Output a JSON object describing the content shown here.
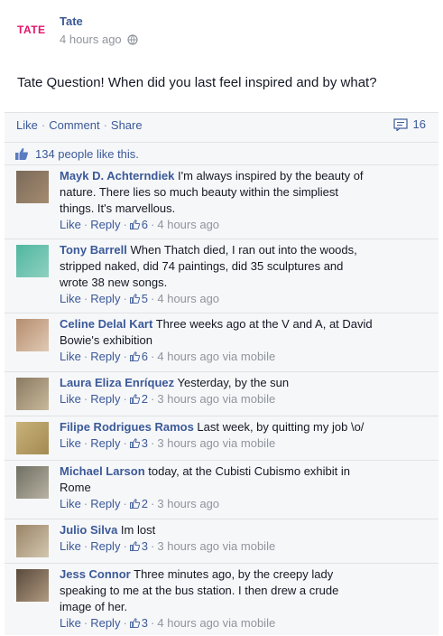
{
  "post": {
    "logo": "TATE",
    "author": "Tate",
    "time": "4 hours ago",
    "text": "Tate Question! When did you last feel inspired and by what?"
  },
  "actions": {
    "like": "Like",
    "comment": "Comment",
    "share": "Share",
    "comment_count": "16"
  },
  "likes": {
    "text": "134 people like this."
  },
  "comments": [
    {
      "name": "Mayk D. Achterndiek",
      "lines": [
        "I'm always inspired by the beauty of",
        "nature. There lies so much beauty within the simpliest",
        "things. It's marvellous."
      ],
      "like": "Like",
      "reply": "Reply",
      "likes": "6",
      "time": "4 hours ago",
      "via": ""
    },
    {
      "name": "Tony Barrell",
      "lines": [
        "When Thatch died, I ran out into the woods,",
        "stripped naked, did 74 paintings, did 35 sculptures and",
        "wrote 38 new songs."
      ],
      "like": "Like",
      "reply": "Reply",
      "likes": "5",
      "time": "4 hours ago",
      "via": ""
    },
    {
      "name": "Celine Delal Kart",
      "lines": [
        "Three weeks ago at the V and A, at David",
        "Bowie's exhibition"
      ],
      "like": "Like",
      "reply": "Reply",
      "likes": "6",
      "time": "4 hours ago",
      "via": "via mobile"
    },
    {
      "name": "Laura Eliza Enríquez",
      "lines": [
        "Yesterday, by the sun"
      ],
      "like": "Like",
      "reply": "Reply",
      "likes": "2",
      "time": "3 hours ago",
      "via": "via mobile"
    },
    {
      "name": "Filipe Rodrigues Ramos",
      "lines": [
        "Last week, by quitting my job \\o/"
      ],
      "like": "Like",
      "reply": "Reply",
      "likes": "3",
      "time": "3 hours ago",
      "via": "via mobile"
    },
    {
      "name": "Michael Larson",
      "lines": [
        "today, at the Cubisti Cubismo exhibit in",
        "Rome"
      ],
      "like": "Like",
      "reply": "Reply",
      "likes": "2",
      "time": "3 hours ago",
      "via": ""
    },
    {
      "name": "Julio Silva",
      "lines": [
        "Im lost"
      ],
      "like": "Like",
      "reply": "Reply",
      "likes": "3",
      "time": "3 hours ago",
      "via": "via mobile"
    },
    {
      "name": "Jess Connor",
      "lines": [
        "Three minutes ago, by the creepy lady",
        "speaking to me at the bus station. I then drew a crude",
        "image of her."
      ],
      "like": "Like",
      "reply": "Reply",
      "likes": "3",
      "time": "4 hours ago",
      "via": "via mobile"
    }
  ],
  "colors": {
    "link": "#3b5998",
    "meta": "#90949c",
    "brand": "#e2156b",
    "panel": "#f6f7f9"
  }
}
